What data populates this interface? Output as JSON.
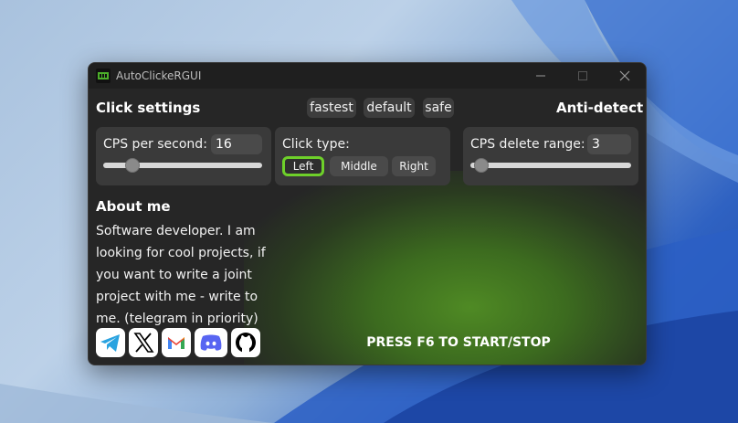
{
  "window": {
    "title": "AutoClickeRGUI"
  },
  "headings": {
    "click_settings": "Click settings",
    "anti_detect": "Anti-detect",
    "about_me": "About me"
  },
  "presets": [
    "fastest",
    "default",
    "safe"
  ],
  "cps": {
    "label": "CPS per second:",
    "value": "16",
    "slider_fraction": 0.18
  },
  "click_type": {
    "label": "Click type:",
    "options": [
      "Left",
      "Middle",
      "Right"
    ],
    "selected": "Left"
  },
  "cps_delete_range": {
    "label": "CPS delete range:",
    "value": "3",
    "slider_fraction": 0.06
  },
  "about_text": "Software developer. I am looking for cool projects, if you want to write a joint project with me - write to me. (telegram in priority)",
  "hotkey_hint": "PRESS F6 TO START/STOP",
  "social_icons": [
    "telegram-icon",
    "x-icon",
    "gmail-icon",
    "discord-icon",
    "github-icon"
  ],
  "colors": {
    "accent_green": "#6ed02a",
    "window_bg": "#262626",
    "card_bg": "#3a3a3a"
  }
}
